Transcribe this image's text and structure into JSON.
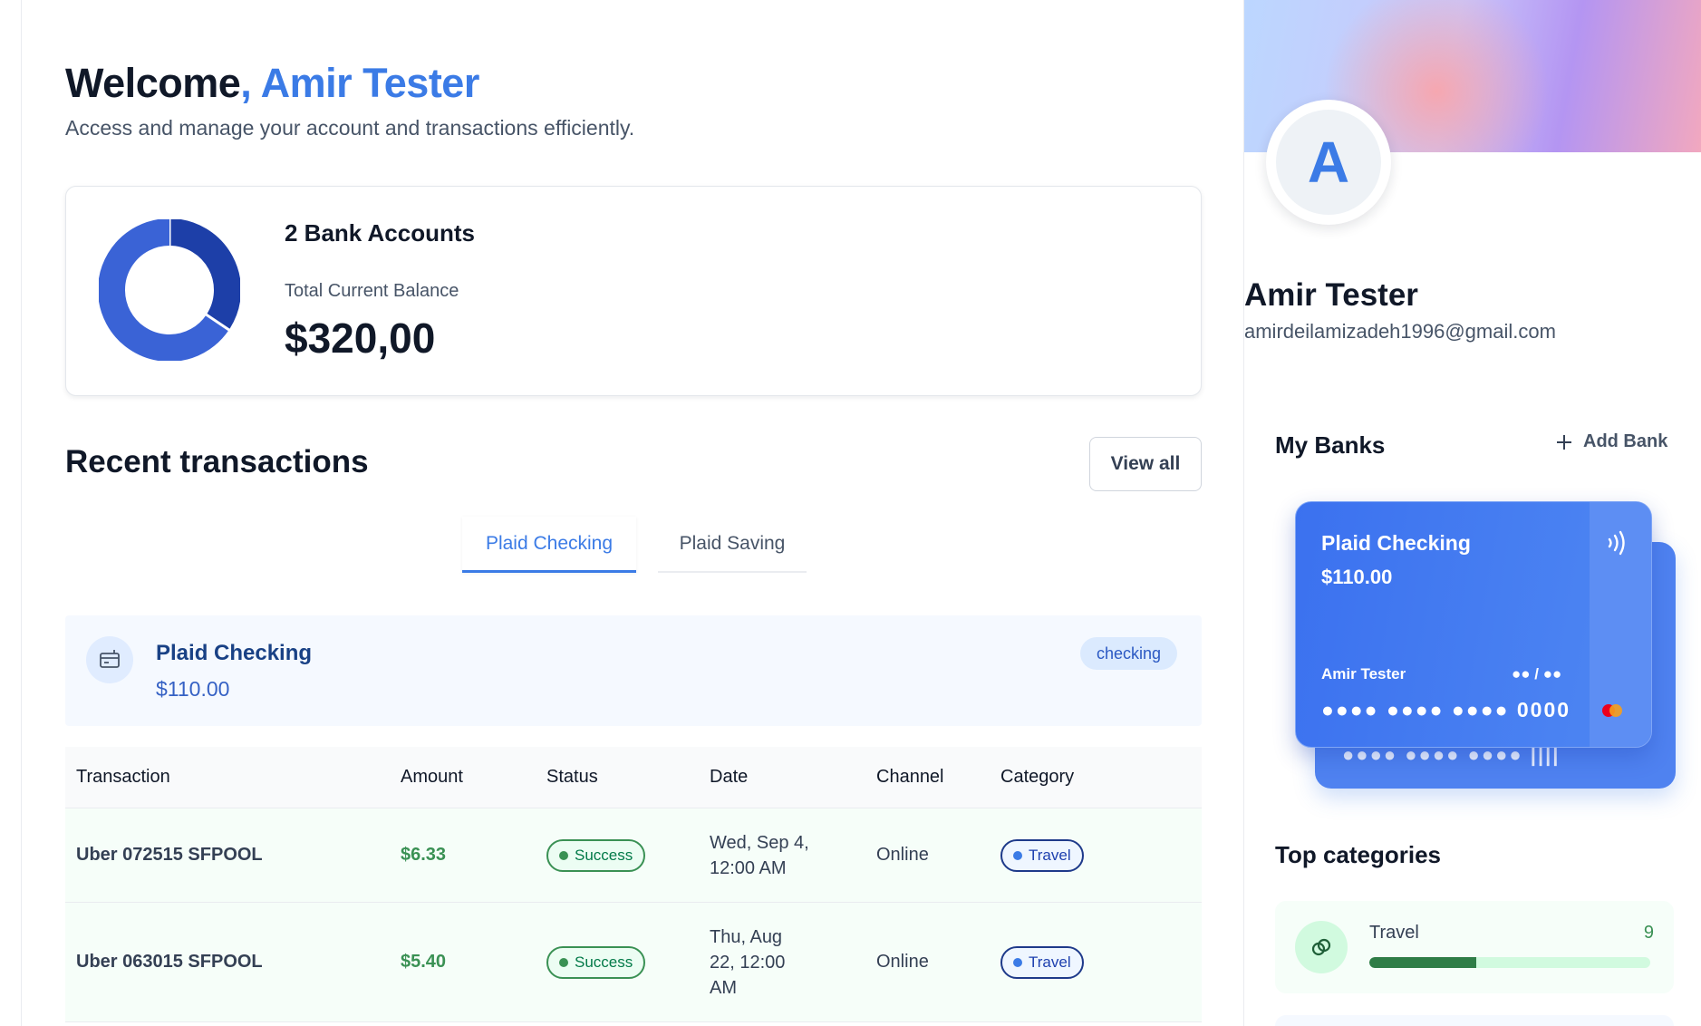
{
  "header": {
    "welcome_prefix": "Welcome",
    "welcome_name": ", Amir Tester",
    "subtitle": "Access and manage your account and transactions efficiently."
  },
  "balance": {
    "bank_count_label": "2 Bank Accounts",
    "total_label": "Total Current Balance",
    "total_value": "$320,00",
    "donut_shares": [
      0.34375,
      0.65625
    ],
    "donut_colors": [
      "#1d3fa8",
      "#3a63d6"
    ]
  },
  "recent": {
    "title": "Recent transactions",
    "view_all": "View all",
    "tabs": [
      {
        "label": "Plaid Checking",
        "active": true
      },
      {
        "label": "Plaid Saving",
        "active": false
      }
    ],
    "account": {
      "name": "Plaid Checking",
      "balance": "$110.00",
      "badge": "checking"
    },
    "columns": [
      "Transaction",
      "Amount",
      "Status",
      "Date",
      "Channel",
      "Category"
    ],
    "rows": [
      {
        "transaction": "Uber 072515 SFPOOL",
        "amount": "$6.33",
        "status": "Success",
        "date": "Wed, Sep 4, 12:00 AM",
        "channel": "Online",
        "category": "Travel"
      },
      {
        "transaction": "Uber 063015 SFPOOL",
        "amount": "$5.40",
        "status": "Success",
        "date": "Thu, Aug 22, 12:00 AM",
        "channel": "Online",
        "category": "Travel"
      }
    ]
  },
  "profile": {
    "initial": "A",
    "name": "Amir Tester",
    "email": "amirdeilamizadeh1996@gmail.com"
  },
  "banks": {
    "title": "My Banks",
    "add_label": "Add Bank",
    "card": {
      "name": "Plaid Checking",
      "amount": "$110.00",
      "holder": "Amir Tester",
      "expiry": "●● / ●●",
      "number": "●●●● ●●●● ●●●● 0000",
      "back_number": "●●●● ●●●● ●●●● ||||"
    }
  },
  "categories": {
    "title": "Top categories",
    "items": [
      {
        "name": "Travel",
        "count": "9",
        "progress": 0.38
      }
    ]
  },
  "colors": {
    "accent": "#3b7be6",
    "success": "#3a9154"
  }
}
